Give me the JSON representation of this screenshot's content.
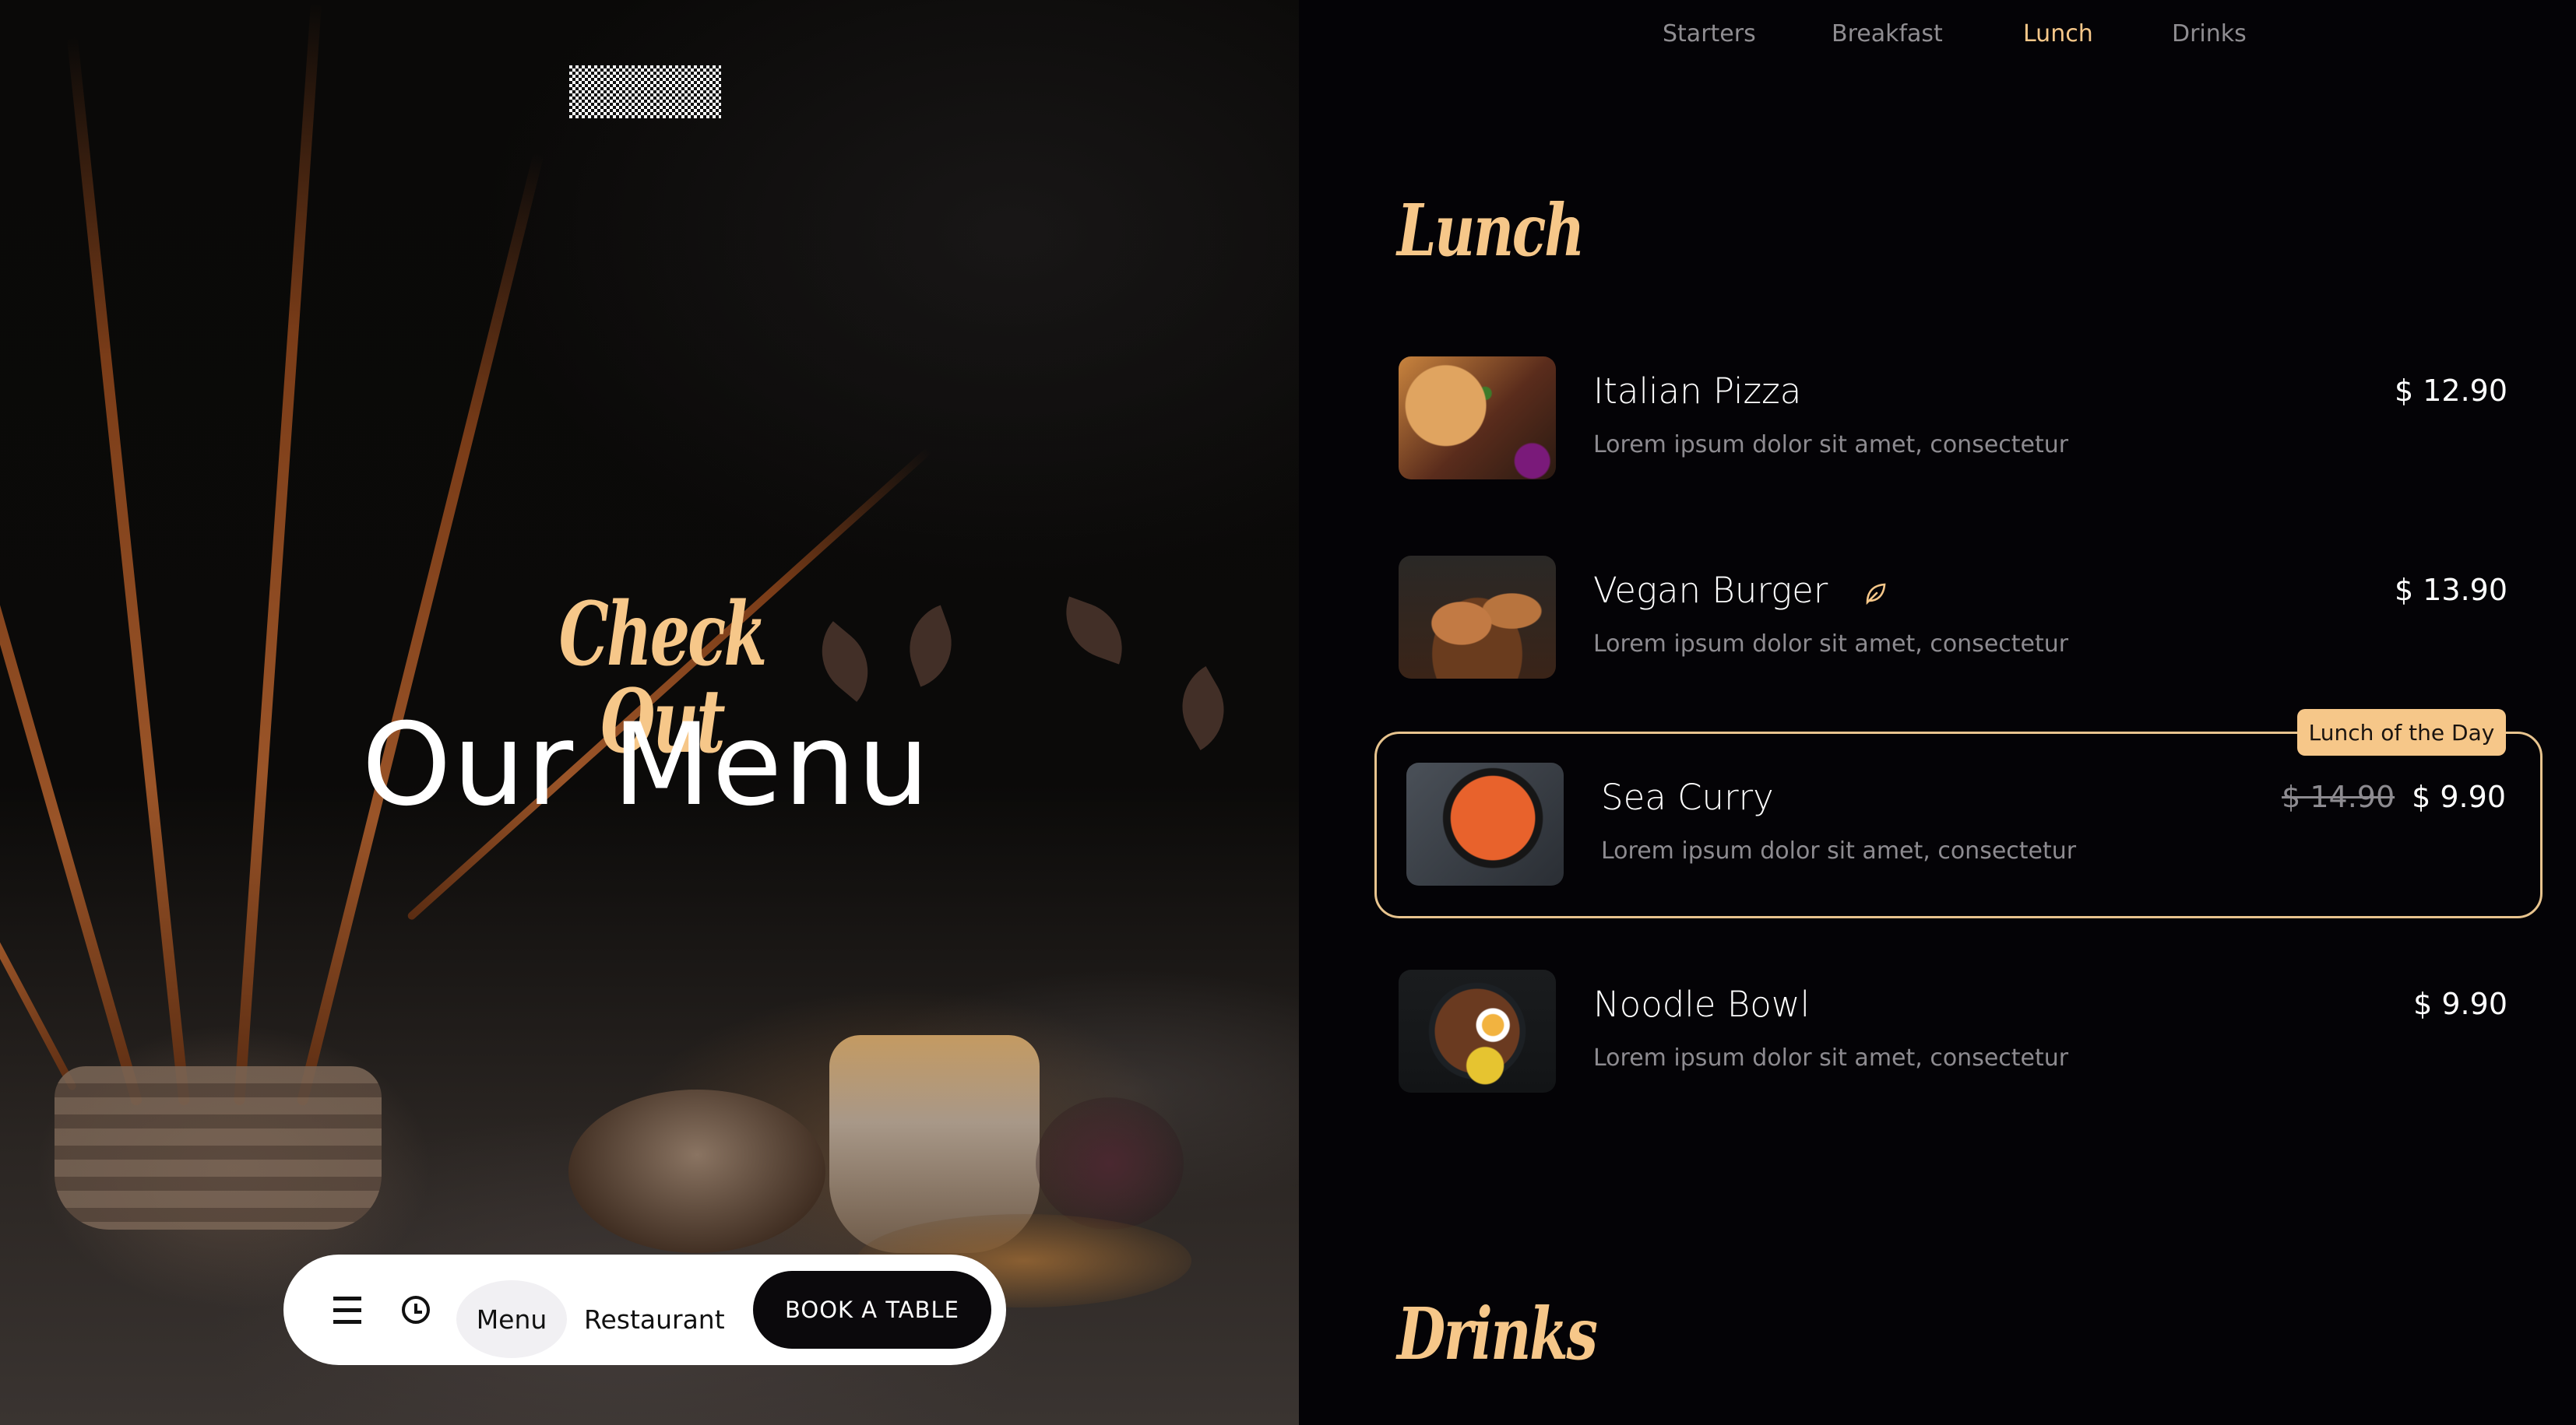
{
  "logo": {
    "alt": "logo placeholder"
  },
  "hero": {
    "kicker": "Check Out",
    "title": "Our Menu"
  },
  "bottom_nav": {
    "menu_icon": "hamburger-icon",
    "hours_icon": "clock-icon",
    "menu_label": "Menu",
    "restaurant_label": "Restaurant",
    "book_label": "BOOK A TABLE"
  },
  "category_tabs": [
    {
      "label": "Starters",
      "active": false
    },
    {
      "label": "Breakfast",
      "active": false
    },
    {
      "label": "Lunch",
      "active": true
    },
    {
      "label": "Drinks",
      "active": false
    }
  ],
  "sections": {
    "lunch": {
      "title": "Lunch",
      "items": [
        {
          "name": "Italian Pizza",
          "description": "Lorem ipsum dolor sit amet, consectetur",
          "price": "$ 12.90",
          "image": "pizza-photo"
        },
        {
          "name": "Vegan Burger",
          "description": "Lorem ipsum dolor sit amet, consectetur",
          "price": "$ 13.90",
          "image": "burger-photo",
          "tag_icon": "leaf-icon"
        },
        {
          "name": "Sea Curry",
          "description": "Lorem ipsum dolor sit amet, consectetur",
          "old_price": "$ 14.90",
          "price": "$ 9.90",
          "image": "paella-photo",
          "badge": "Lunch of the Day",
          "featured": true
        },
        {
          "name": "Noodle Bowl",
          "description": "Lorem ipsum dolor sit amet, consectetur",
          "price": "$ 9.90",
          "image": "noodle-bowl-photo"
        }
      ]
    },
    "drinks": {
      "title": "Drinks"
    }
  },
  "colors": {
    "accent": "#f6c789",
    "background": "#040306",
    "muted_text": "#8d8b90",
    "pill_bg": "#ffffff",
    "button_dark": "#0b090c"
  }
}
